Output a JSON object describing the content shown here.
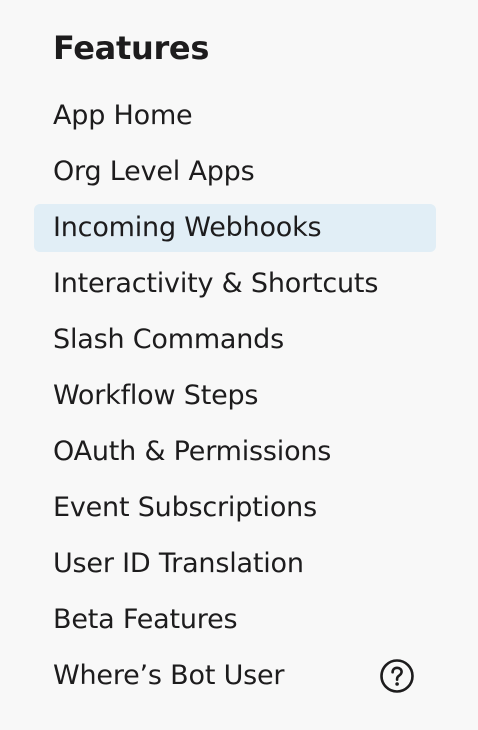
{
  "sidebar": {
    "title": "Features",
    "items": [
      {
        "label": "App Home"
      },
      {
        "label": "Org Level Apps"
      },
      {
        "label": "Incoming Webhooks",
        "active": true
      },
      {
        "label": "Interactivity & Shortcuts"
      },
      {
        "label": "Slash Commands"
      },
      {
        "label": "Workflow Steps"
      },
      {
        "label": "OAuth & Permissions"
      },
      {
        "label": "Event Subscriptions"
      },
      {
        "label": "User ID Translation"
      },
      {
        "label": "Beta Features"
      },
      {
        "label": "Where’s Bot User",
        "icon": "help-circle-icon"
      }
    ]
  },
  "colors": {
    "background": "#f8f8f8",
    "active_item_background": "#e1eef6",
    "text": "#1d1c1d"
  }
}
